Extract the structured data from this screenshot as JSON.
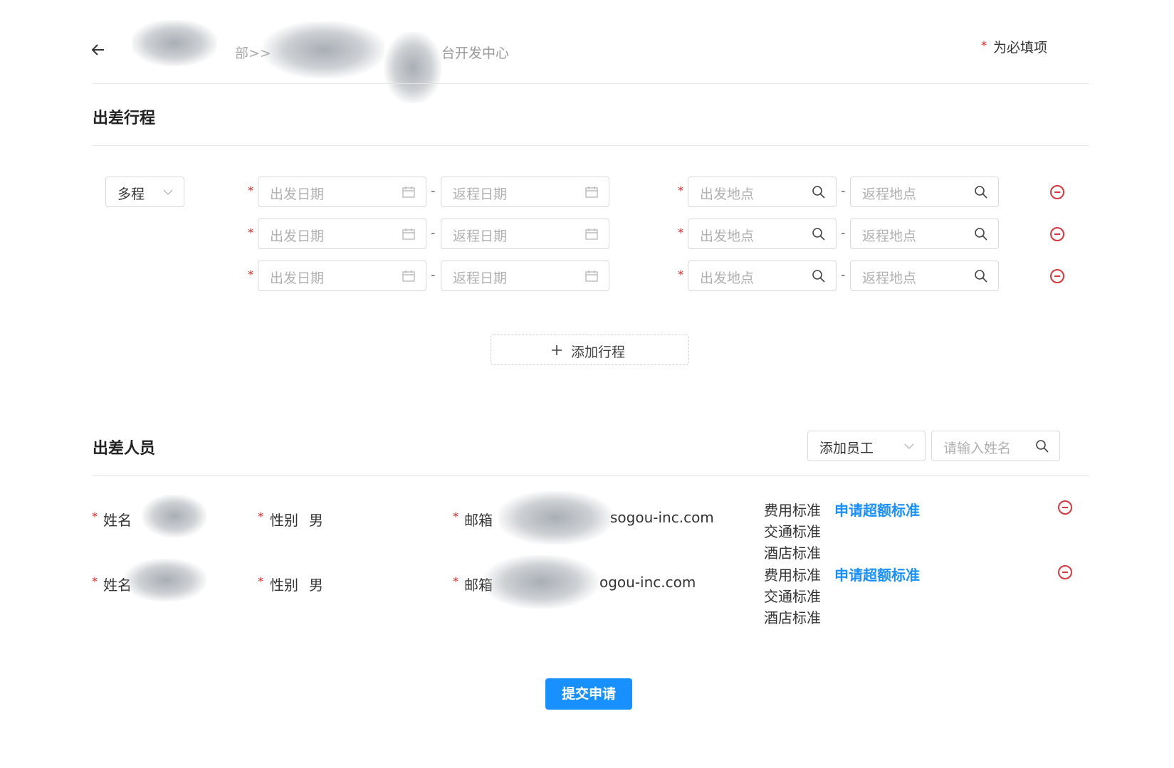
{
  "header": {
    "back_icon": "arrow-left-icon",
    "breadcrumb_part1": "部>>",
    "breadcrumb_part2": "台开发中心",
    "required_note_mark": "*",
    "required_note": "为必填项"
  },
  "trip": {
    "section_title": "出差行程",
    "trip_type": "多程",
    "rows": [
      {
        "depart_date_placeholder": "出发日期",
        "return_date_placeholder": "返程日期",
        "from_placeholder": "出发地点",
        "to_placeholder": "返程地点"
      },
      {
        "depart_date_placeholder": "出发日期",
        "return_date_placeholder": "返程日期",
        "from_placeholder": "出发地点",
        "to_placeholder": "返程地点"
      },
      {
        "depart_date_placeholder": "出发日期",
        "return_date_placeholder": "返程日期",
        "from_placeholder": "出发地点",
        "to_placeholder": "返程地点"
      }
    ],
    "separator": "-",
    "add_trip_label": "添加行程",
    "add_icon": "plus-icon"
  },
  "staff": {
    "section_title": "出差人员",
    "add_employee_label": "添加员工",
    "search_placeholder": "请输入姓名",
    "people": [
      {
        "name_label": "姓名",
        "gender_label": "性别",
        "gender_value": "男",
        "email_label": "邮箱",
        "email_value": "sogou-inc.com",
        "expense_label": "费用标准",
        "apply_over_label": "申请超额标准",
        "transport_label": "交通标准",
        "hotel_label": "酒店标准"
      },
      {
        "name_label": "姓名",
        "gender_label": "性别",
        "gender_value": "男",
        "email_label": "邮箱",
        "email_value": "ogou-inc.com",
        "expense_label": "费用标准",
        "apply_over_label": "申请超额标准",
        "transport_label": "交通标准",
        "hotel_label": "酒店标准"
      }
    ]
  },
  "submit_label": "提交申请",
  "colors": {
    "accent": "#1890ff",
    "danger": "#d9363e",
    "required": "#e02020"
  }
}
